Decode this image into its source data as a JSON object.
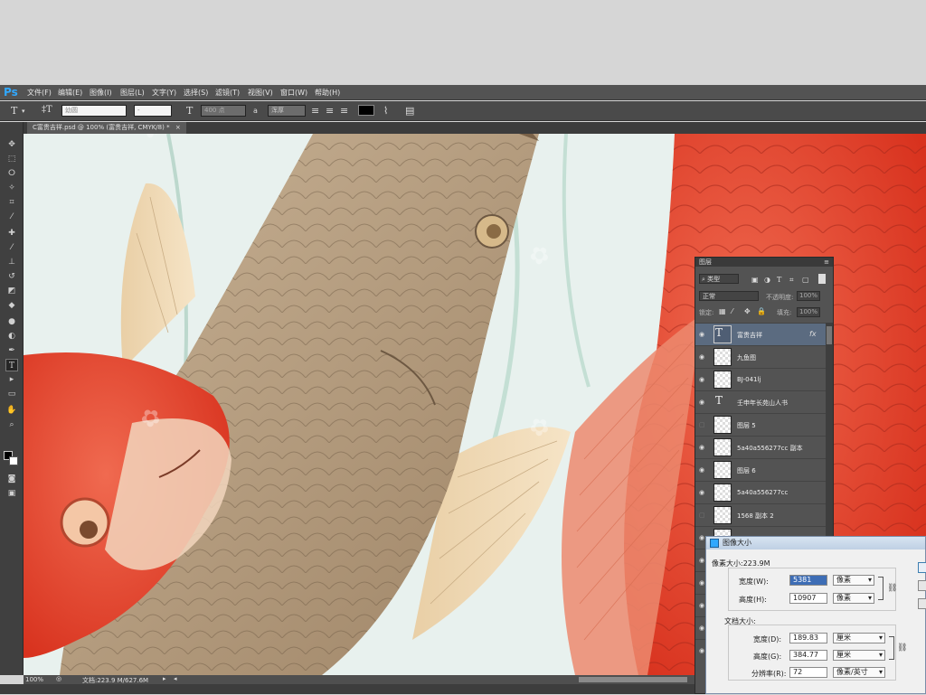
{
  "app": {
    "logo": "Ps"
  },
  "menu": [
    "文件(F)",
    "编辑(E)",
    "图像(I)",
    "图层(L)",
    "文字(Y)",
    "选择(S)",
    "滤镜(T)",
    "视图(V)",
    "窗口(W)",
    "帮助(H)"
  ],
  "options": {
    "font_family": "幼圆",
    "font_style": "-",
    "font_size": "400 点",
    "aa_label": "a",
    "aa_mode": "浑厚",
    "color": "#000000"
  },
  "document_tab": "C富贵吉祥.psd @ 100% (富贵吉祥, CMYK/8) *",
  "status": {
    "zoom": "100%",
    "doc": "文档:223.9 M/627.6M"
  },
  "layers_panel": {
    "title": "图层",
    "filter": "类型",
    "blend_mode": "正常",
    "opacity_label": "不透明度:",
    "opacity": "100%",
    "lock_label": "锁定:",
    "fill_label": "填充:",
    "fill": "100%",
    "layers": [
      {
        "name": "富贵吉祥",
        "kind": "text",
        "visible": true,
        "selected": true,
        "fx": "fx"
      },
      {
        "name": "九鱼图",
        "kind": "image",
        "visible": true
      },
      {
        "name": "BJ-041lj",
        "kind": "image",
        "visible": true
      },
      {
        "name": "壬申年长苑山人书",
        "kind": "text",
        "visible": true
      },
      {
        "name": "图层 5",
        "kind": "checker",
        "visible": false
      },
      {
        "name": "5a40a556277cc 副本",
        "kind": "image",
        "visible": true
      },
      {
        "name": "图层 6",
        "kind": "checker",
        "visible": true
      },
      {
        "name": "5a40a556277cc",
        "kind": "image",
        "visible": true
      },
      {
        "name": "1568 副本 2",
        "kind": "image",
        "visible": false
      }
    ]
  },
  "dialog": {
    "title": "图像大小",
    "pixel_size": "像素大小:223.9M",
    "width_label": "宽度(W):",
    "width_value": "5381",
    "width_unit": "像素",
    "height_label": "高度(H):",
    "height_value": "10907",
    "height_unit": "像素",
    "doc_size": "文档大小:",
    "doc_width_label": "宽度(D):",
    "doc_width_value": "189.83",
    "doc_width_unit": "厘米",
    "doc_height_label": "高度(G):",
    "doc_height_value": "384.77",
    "doc_height_unit": "厘米",
    "res_label": "分辨率(R):",
    "res_value": "72",
    "res_unit": "像素/英寸"
  },
  "colors": {
    "accent": "#31a8ff",
    "koi_red": "#e8452e",
    "koi_tan": "#b49a7c"
  }
}
